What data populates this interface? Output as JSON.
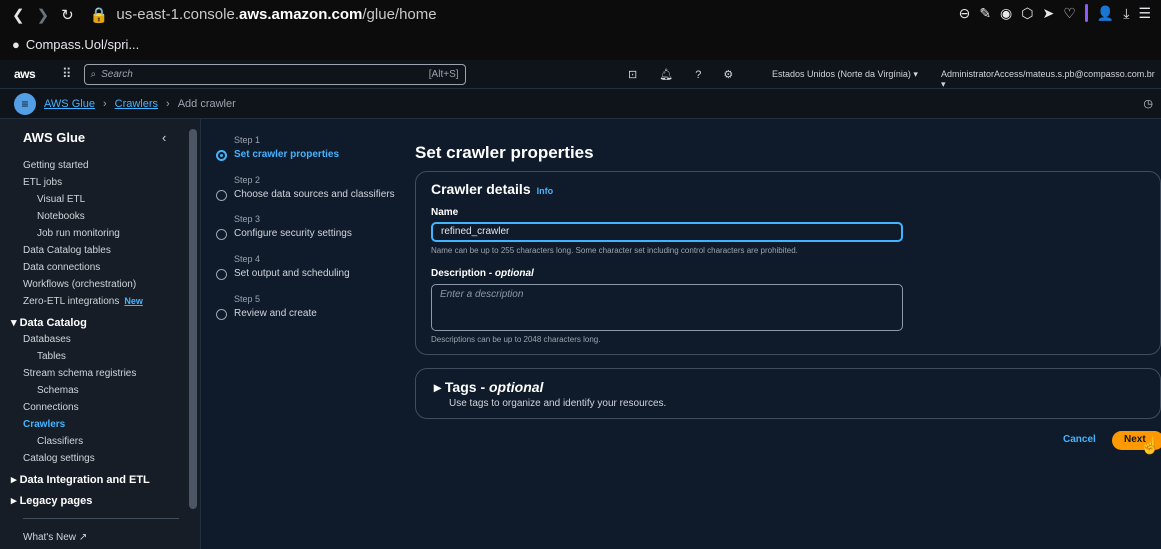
{
  "browser": {
    "url_prefix": "us-east-1.console.",
    "url_domain": "aws.amazon.com",
    "url_path": "/glue/home",
    "bookmark": "Compass.Uol/spri..."
  },
  "topbar": {
    "logo": "aws",
    "search_placeholder": "Search",
    "search_shortcut": "[Alt+S]",
    "region": "Estados Unidos (Norte da Virgínia) ▾",
    "account": "AdministratorAccess/mateus.s.pb@compasso.com.br ▾"
  },
  "breadcrumb": {
    "items": [
      "AWS Glue",
      "Crawlers"
    ],
    "current": "Add crawler"
  },
  "sidebar": {
    "title": "AWS Glue",
    "items": [
      {
        "label": "Getting started"
      },
      {
        "label": "ETL jobs"
      },
      {
        "label": "Visual ETL"
      },
      {
        "label": "Notebooks"
      },
      {
        "label": "Job run monitoring"
      },
      {
        "label": "Data Catalog tables"
      },
      {
        "label": "Data connections"
      },
      {
        "label": "Workflows (orchestration)"
      },
      {
        "label": "Zero-ETL integrations",
        "badge": "New"
      },
      {
        "label": "Data Catalog"
      },
      {
        "label": "Databases"
      },
      {
        "label": "Tables"
      },
      {
        "label": "Stream schema registries"
      },
      {
        "label": "Schemas"
      },
      {
        "label": "Connections"
      },
      {
        "label": "Crawlers"
      },
      {
        "label": "Classifiers"
      },
      {
        "label": "Catalog settings"
      },
      {
        "label": "Data Integration and ETL"
      },
      {
        "label": "Legacy pages"
      },
      {
        "label": "What's New"
      }
    ]
  },
  "steps": [
    {
      "step": "Step 1",
      "label": "Set crawler properties"
    },
    {
      "step": "Step 2",
      "label": "Choose data sources and classifiers"
    },
    {
      "step": "Step 3",
      "label": "Configure security settings"
    },
    {
      "step": "Step 4",
      "label": "Set output and scheduling"
    },
    {
      "step": "Step 5",
      "label": "Review and create"
    }
  ],
  "main": {
    "title": "Set crawler properties",
    "details_title": "Crawler details",
    "info": "Info",
    "name_label": "Name",
    "name_value": "refined_crawler",
    "name_hint": "Name can be up to 255 characters long. Some character set including control characters are prohibited.",
    "desc_label": "Description - ",
    "desc_optional": "optional",
    "desc_placeholder": "Enter a description",
    "desc_hint": "Descriptions can be up to 2048 characters long.",
    "tags_title": "Tags - ",
    "tags_optional": "optional",
    "tags_desc": "Use tags to organize and identify your resources.",
    "cancel": "Cancel",
    "next": "Next"
  },
  "colors": {
    "accent": "#42b4ff",
    "primary_button": "#ff9900",
    "background": "#0f1b2a"
  }
}
